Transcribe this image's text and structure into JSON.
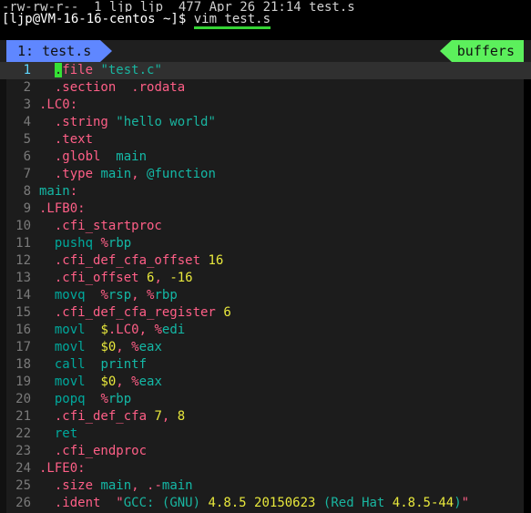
{
  "terminal": {
    "scrollback_partial": "-rw-rw-r--  1 ljp ljp  477 Apr 26 21:14 test.s",
    "prompt": "[ljp@VM-16-16-centos ~]$ ",
    "command": "vim test.s"
  },
  "vim": {
    "tabline": {
      "tab_label": "1: test.s",
      "right_label": "buffers",
      "tab_color": "#5f87ff",
      "right_color": "#5cf05c"
    },
    "cursor": {
      "line": 1,
      "column": 2
    },
    "lines": [
      {
        "num": "1",
        "tokens": [
          {
            "t": "  ",
            "c": "w"
          },
          {
            "t": ".",
            "c": "cur"
          },
          {
            "t": "file ",
            "c": "d"
          },
          {
            "t": "\"test.c\"",
            "c": "s"
          }
        ]
      },
      {
        "num": "2",
        "tokens": [
          {
            "t": "  ",
            "c": "w"
          },
          {
            "t": ".section",
            "c": "d"
          },
          {
            "t": "  ",
            "c": "w"
          },
          {
            "t": ".rodata",
            "c": "d"
          }
        ]
      },
      {
        "num": "3",
        "tokens": [
          {
            "t": ".LC0:",
            "c": "d"
          }
        ]
      },
      {
        "num": "4",
        "tokens": [
          {
            "t": "  ",
            "c": "w"
          },
          {
            "t": ".string ",
            "c": "d"
          },
          {
            "t": "\"hello world\"",
            "c": "s"
          }
        ]
      },
      {
        "num": "5",
        "tokens": [
          {
            "t": "  ",
            "c": "w"
          },
          {
            "t": ".text",
            "c": "d"
          }
        ]
      },
      {
        "num": "6",
        "tokens": [
          {
            "t": "  ",
            "c": "w"
          },
          {
            "t": ".globl",
            "c": "d"
          },
          {
            "t": "  ",
            "c": "w"
          },
          {
            "t": "main",
            "c": "id"
          }
        ]
      },
      {
        "num": "7",
        "tokens": [
          {
            "t": "  ",
            "c": "w"
          },
          {
            "t": ".type ",
            "c": "d"
          },
          {
            "t": "main",
            "c": "id"
          },
          {
            "t": ",",
            "c": "d"
          },
          {
            "t": " ",
            "c": "w"
          },
          {
            "t": "@function",
            "c": "id"
          }
        ]
      },
      {
        "num": "8",
        "tokens": [
          {
            "t": "main",
            "c": "id"
          },
          {
            "t": ":",
            "c": "d"
          }
        ]
      },
      {
        "num": "9",
        "tokens": [
          {
            "t": ".LFB0:",
            "c": "d"
          }
        ]
      },
      {
        "num": "10",
        "tokens": [
          {
            "t": "  ",
            "c": "w"
          },
          {
            "t": ".cfi_startproc",
            "c": "d"
          }
        ]
      },
      {
        "num": "11",
        "tokens": [
          {
            "t": "  ",
            "c": "w"
          },
          {
            "t": "pushq",
            "c": "k"
          },
          {
            "t": " ",
            "c": "w"
          },
          {
            "t": "%",
            "c": "p"
          },
          {
            "t": "rbp",
            "c": "id"
          }
        ]
      },
      {
        "num": "12",
        "tokens": [
          {
            "t": "  ",
            "c": "w"
          },
          {
            "t": ".cfi_def_cfa_offset",
            "c": "d"
          },
          {
            "t": " ",
            "c": "w"
          },
          {
            "t": "16",
            "c": "n"
          }
        ]
      },
      {
        "num": "13",
        "tokens": [
          {
            "t": "  ",
            "c": "w"
          },
          {
            "t": ".cfi_offset",
            "c": "d"
          },
          {
            "t": " ",
            "c": "w"
          },
          {
            "t": "6",
            "c": "n"
          },
          {
            "t": ",",
            "c": "d"
          },
          {
            "t": " ",
            "c": "w"
          },
          {
            "t": "-16",
            "c": "n"
          }
        ]
      },
      {
        "num": "14",
        "tokens": [
          {
            "t": "  ",
            "c": "w"
          },
          {
            "t": "movq",
            "c": "k"
          },
          {
            "t": "  ",
            "c": "w"
          },
          {
            "t": "%",
            "c": "p"
          },
          {
            "t": "rsp",
            "c": "id"
          },
          {
            "t": ",",
            "c": "d"
          },
          {
            "t": " ",
            "c": "w"
          },
          {
            "t": "%",
            "c": "p"
          },
          {
            "t": "rbp",
            "c": "id"
          }
        ]
      },
      {
        "num": "15",
        "tokens": [
          {
            "t": "  ",
            "c": "w"
          },
          {
            "t": ".cfi_def_cfa_register",
            "c": "d"
          },
          {
            "t": " ",
            "c": "w"
          },
          {
            "t": "6",
            "c": "n"
          }
        ]
      },
      {
        "num": "16",
        "tokens": [
          {
            "t": "  ",
            "c": "w"
          },
          {
            "t": "movl",
            "c": "k"
          },
          {
            "t": "  ",
            "c": "w"
          },
          {
            "t": "$",
            "c": "y"
          },
          {
            "t": ".LC0",
            "c": "d"
          },
          {
            "t": ",",
            "c": "d"
          },
          {
            "t": " ",
            "c": "w"
          },
          {
            "t": "%",
            "c": "p"
          },
          {
            "t": "edi",
            "c": "id"
          }
        ]
      },
      {
        "num": "17",
        "tokens": [
          {
            "t": "  ",
            "c": "w"
          },
          {
            "t": "movl",
            "c": "k"
          },
          {
            "t": "  ",
            "c": "w"
          },
          {
            "t": "$0",
            "c": "n"
          },
          {
            "t": ",",
            "c": "d"
          },
          {
            "t": " ",
            "c": "w"
          },
          {
            "t": "%",
            "c": "p"
          },
          {
            "t": "eax",
            "c": "id"
          }
        ]
      },
      {
        "num": "18",
        "tokens": [
          {
            "t": "  ",
            "c": "w"
          },
          {
            "t": "call",
            "c": "k"
          },
          {
            "t": "  ",
            "c": "w"
          },
          {
            "t": "printf",
            "c": "id"
          }
        ]
      },
      {
        "num": "19",
        "tokens": [
          {
            "t": "  ",
            "c": "w"
          },
          {
            "t": "movl",
            "c": "k"
          },
          {
            "t": "  ",
            "c": "w"
          },
          {
            "t": "$0",
            "c": "n"
          },
          {
            "t": ",",
            "c": "d"
          },
          {
            "t": " ",
            "c": "w"
          },
          {
            "t": "%",
            "c": "p"
          },
          {
            "t": "eax",
            "c": "id"
          }
        ]
      },
      {
        "num": "20",
        "tokens": [
          {
            "t": "  ",
            "c": "w"
          },
          {
            "t": "popq",
            "c": "k"
          },
          {
            "t": "  ",
            "c": "w"
          },
          {
            "t": "%",
            "c": "p"
          },
          {
            "t": "rbp",
            "c": "id"
          }
        ]
      },
      {
        "num": "21",
        "tokens": [
          {
            "t": "  ",
            "c": "w"
          },
          {
            "t": ".cfi_def_cfa",
            "c": "d"
          },
          {
            "t": " ",
            "c": "w"
          },
          {
            "t": "7",
            "c": "n"
          },
          {
            "t": ",",
            "c": "d"
          },
          {
            "t": " ",
            "c": "w"
          },
          {
            "t": "8",
            "c": "n"
          }
        ]
      },
      {
        "num": "22",
        "tokens": [
          {
            "t": "  ",
            "c": "w"
          },
          {
            "t": "ret",
            "c": "k"
          }
        ]
      },
      {
        "num": "23",
        "tokens": [
          {
            "t": "  ",
            "c": "w"
          },
          {
            "t": ".cfi_endproc",
            "c": "d"
          }
        ]
      },
      {
        "num": "24",
        "tokens": [
          {
            "t": ".LFE0:",
            "c": "d"
          }
        ]
      },
      {
        "num": "25",
        "tokens": [
          {
            "t": "  ",
            "c": "w"
          },
          {
            "t": ".size ",
            "c": "d"
          },
          {
            "t": "main",
            "c": "id"
          },
          {
            "t": ",",
            "c": "d"
          },
          {
            "t": " ",
            "c": "w"
          },
          {
            "t": ".-",
            "c": "d"
          },
          {
            "t": "main",
            "c": "id"
          }
        ]
      },
      {
        "num": "26",
        "tokens": [
          {
            "t": "  ",
            "c": "w"
          },
          {
            "t": ".ident",
            "c": "d"
          },
          {
            "t": "  ",
            "c": "w"
          },
          {
            "t": "\"",
            "c": "d"
          },
          {
            "t": "GCC: ",
            "c": "s"
          },
          {
            "t": "(GNU) ",
            "c": "s"
          },
          {
            "t": "4.8.5 20150623",
            "c": "n"
          },
          {
            "t": " ",
            "c": "w"
          },
          {
            "t": "(",
            "c": "s"
          },
          {
            "t": "Red Hat ",
            "c": "s"
          },
          {
            "t": "4.8.5-44",
            "c": "n"
          },
          {
            "t": ")",
            "c": "s"
          },
          {
            "t": "\"",
            "c": "d"
          }
        ]
      }
    ]
  }
}
